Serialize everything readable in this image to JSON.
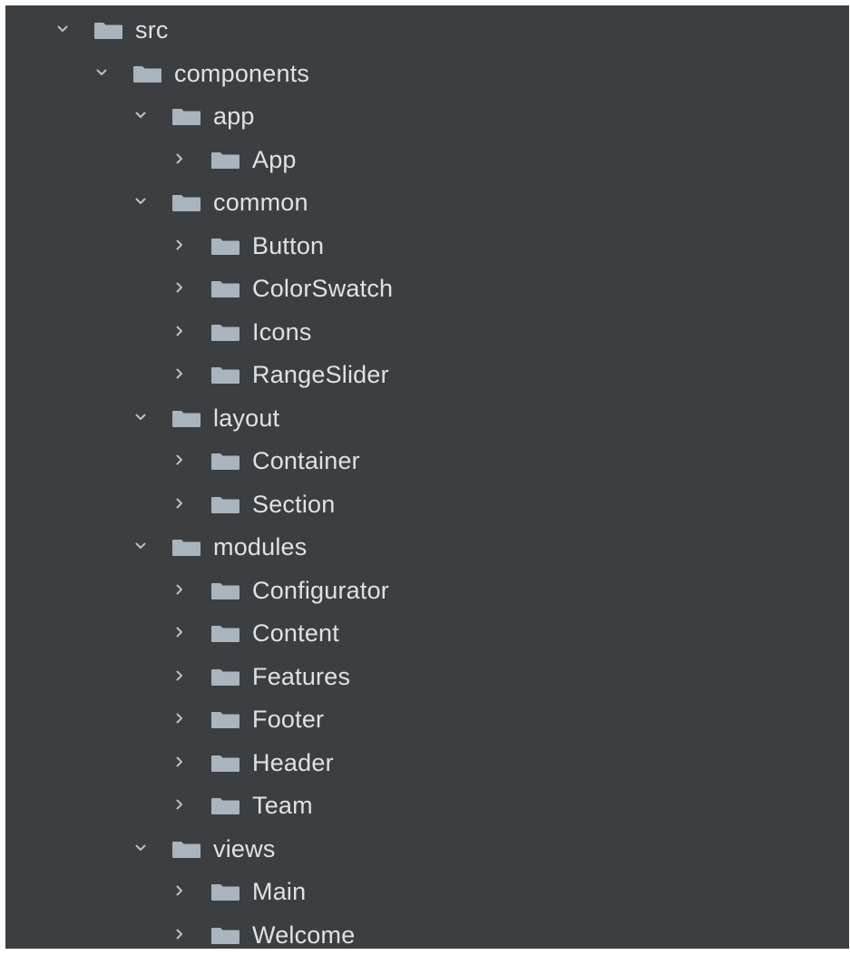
{
  "tree": {
    "items": [
      {
        "label": "src",
        "depth": 0,
        "expanded": true
      },
      {
        "label": "components",
        "depth": 1,
        "expanded": true
      },
      {
        "label": "app",
        "depth": 2,
        "expanded": true
      },
      {
        "label": "App",
        "depth": 3,
        "expanded": false
      },
      {
        "label": "common",
        "depth": 2,
        "expanded": true
      },
      {
        "label": "Button",
        "depth": 3,
        "expanded": false
      },
      {
        "label": "ColorSwatch",
        "depth": 3,
        "expanded": false
      },
      {
        "label": "Icons",
        "depth": 3,
        "expanded": false
      },
      {
        "label": "RangeSlider",
        "depth": 3,
        "expanded": false
      },
      {
        "label": "layout",
        "depth": 2,
        "expanded": true
      },
      {
        "label": "Container",
        "depth": 3,
        "expanded": false
      },
      {
        "label": "Section",
        "depth": 3,
        "expanded": false
      },
      {
        "label": "modules",
        "depth": 2,
        "expanded": true
      },
      {
        "label": "Configurator",
        "depth": 3,
        "expanded": false
      },
      {
        "label": "Content",
        "depth": 3,
        "expanded": false
      },
      {
        "label": "Features",
        "depth": 3,
        "expanded": false
      },
      {
        "label": "Footer",
        "depth": 3,
        "expanded": false
      },
      {
        "label": "Header",
        "depth": 3,
        "expanded": false
      },
      {
        "label": "Team",
        "depth": 3,
        "expanded": false
      },
      {
        "label": "views",
        "depth": 2,
        "expanded": true
      },
      {
        "label": "Main",
        "depth": 3,
        "expanded": false
      },
      {
        "label": "Welcome",
        "depth": 3,
        "expanded": false
      }
    ]
  },
  "icons": {
    "expanded": "chevron-down-icon",
    "collapsed": "chevron-right-icon",
    "folder": "folder-icon"
  },
  "colors": {
    "background": "#3c3f41",
    "text": "#dfe1e5",
    "folder": "#a9b4be",
    "chevron": "#bcc1c5"
  }
}
